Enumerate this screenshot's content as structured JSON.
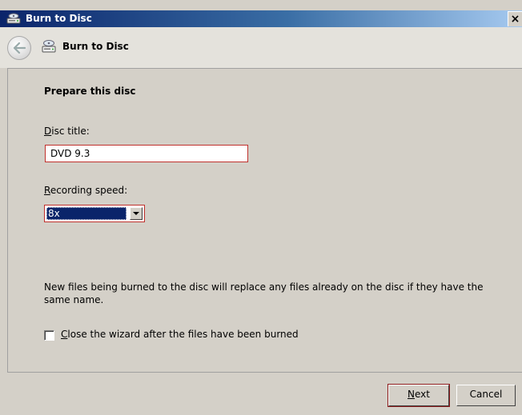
{
  "window": {
    "title": "Burn to Disc",
    "close_label": "×"
  },
  "nav": {
    "title": "Burn to Disc"
  },
  "page": {
    "heading": "Prepare this disc",
    "disc_title_label_accel": "D",
    "disc_title_label_rest": "isc title:",
    "disc_title_value": "DVD 9.3",
    "speed_label_accel": "R",
    "speed_label_rest": "ecording speed:",
    "speed_value": "8x",
    "info_text": "New files being burned to the disc will replace any files already on the disc if they have the same name.",
    "close_wizard_accel": "C",
    "close_wizard_rest": "lose the wizard after the files have been burned",
    "close_wizard_checked": false
  },
  "buttons": {
    "next_accel": "N",
    "next_rest": "ext",
    "cancel": "Cancel"
  },
  "icons": {
    "window_icon": "burn-disc-icon",
    "nav_icon": "burn-disc-icon",
    "back": "back-arrow-icon"
  }
}
